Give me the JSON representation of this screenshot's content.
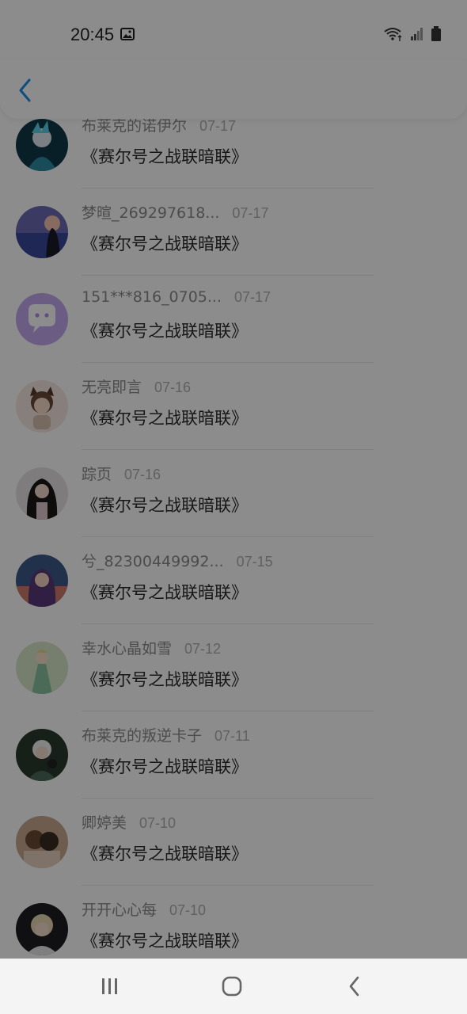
{
  "status_bar": {
    "time": "20:45",
    "icons": [
      "image-icon",
      "wifi-icon",
      "signal-icon",
      "battery-icon"
    ]
  },
  "header": {
    "back_icon": "chevron-left-icon",
    "accent": "#1a8fe8"
  },
  "comments": [
    {
      "name": "布莱克的诺伊尔",
      "date": "07-17",
      "content": "《赛尔号之战联暗联》",
      "avatar": "anime-warrior-avatar"
    },
    {
      "name": "梦暄_269297618...",
      "date": "07-17",
      "content": "《赛尔号之战联暗联》",
      "avatar": "sunset-girl-avatar"
    },
    {
      "name": "151***816_0705...",
      "date": "07-17",
      "content": "《赛尔号之战联暗联》",
      "avatar": "default-chat-avatar"
    },
    {
      "name": "无亮即言",
      "date": "07-16",
      "content": "《赛尔号之战联暗联》",
      "avatar": "chibi-cat-avatar"
    },
    {
      "name": "踪页",
      "date": "07-16",
      "content": "《赛尔号之战联暗联》",
      "avatar": "dark-hair-girl-avatar"
    },
    {
      "name": "兮_82300449992...",
      "date": "07-15",
      "content": "《赛尔号之战联暗联》",
      "avatar": "purple-hair-avatar"
    },
    {
      "name": "幸水心晶如雪",
      "date": "07-12",
      "content": "《赛尔号之战联暗联》",
      "avatar": "green-dress-avatar"
    },
    {
      "name": "布莱克的叛逆卡子",
      "date": "07-11",
      "content": "《赛尔号之战联暗联》",
      "avatar": "white-hair-avatar"
    },
    {
      "name": "卿婷美",
      "date": "07-10",
      "content": "《赛尔号之战联暗联》",
      "avatar": "couple-avatar"
    },
    {
      "name": "开开心心每",
      "date": "07-10",
      "content": "《赛尔号之战联暗联》",
      "avatar": "blonde-boy-avatar"
    }
  ],
  "nav_bar": {
    "buttons": [
      "recents-button",
      "home-button",
      "back-button"
    ]
  }
}
